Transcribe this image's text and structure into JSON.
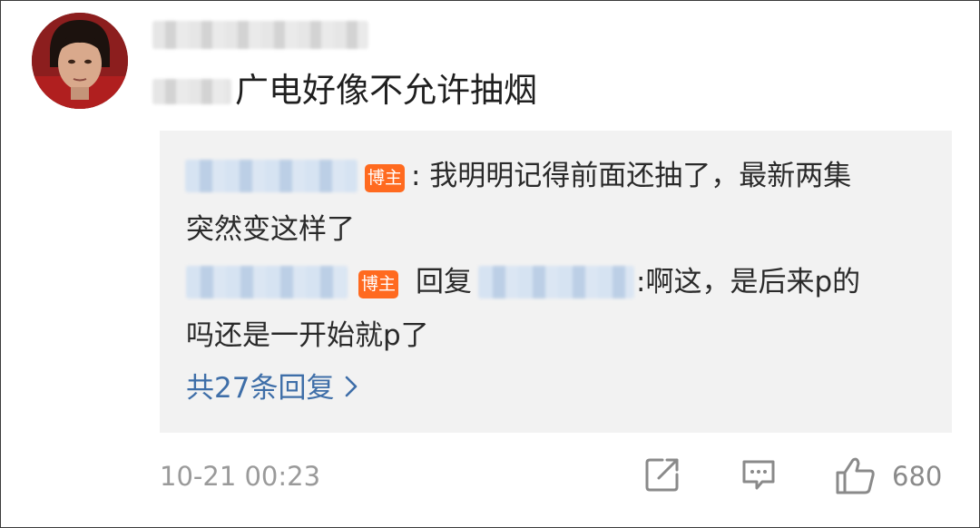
{
  "comment": {
    "text": "广电好像不允许抽烟"
  },
  "replies": {
    "badge": "博主",
    "reply1": {
      "line1": ": 我明明记得前面还抽了，最新两集",
      "line2": "突然变这样了"
    },
    "reply2": {
      "reply_word": "回复",
      "line1": ":啊这，是后来p的",
      "line2": "吗还是一开始就p了"
    },
    "more_label": "共27条回复"
  },
  "footer": {
    "time": "10-21 00:23",
    "likes": "680"
  },
  "icons": {
    "share": "share-icon",
    "comment": "comment-icon",
    "like": "thumbs-up-icon",
    "more_chevron": "chevron-right-icon"
  },
  "colors": {
    "badge": "#ff6a1f",
    "link": "#3e6ea8",
    "reply_bg": "#f2f2f2",
    "meta": "#9a9a9a"
  }
}
